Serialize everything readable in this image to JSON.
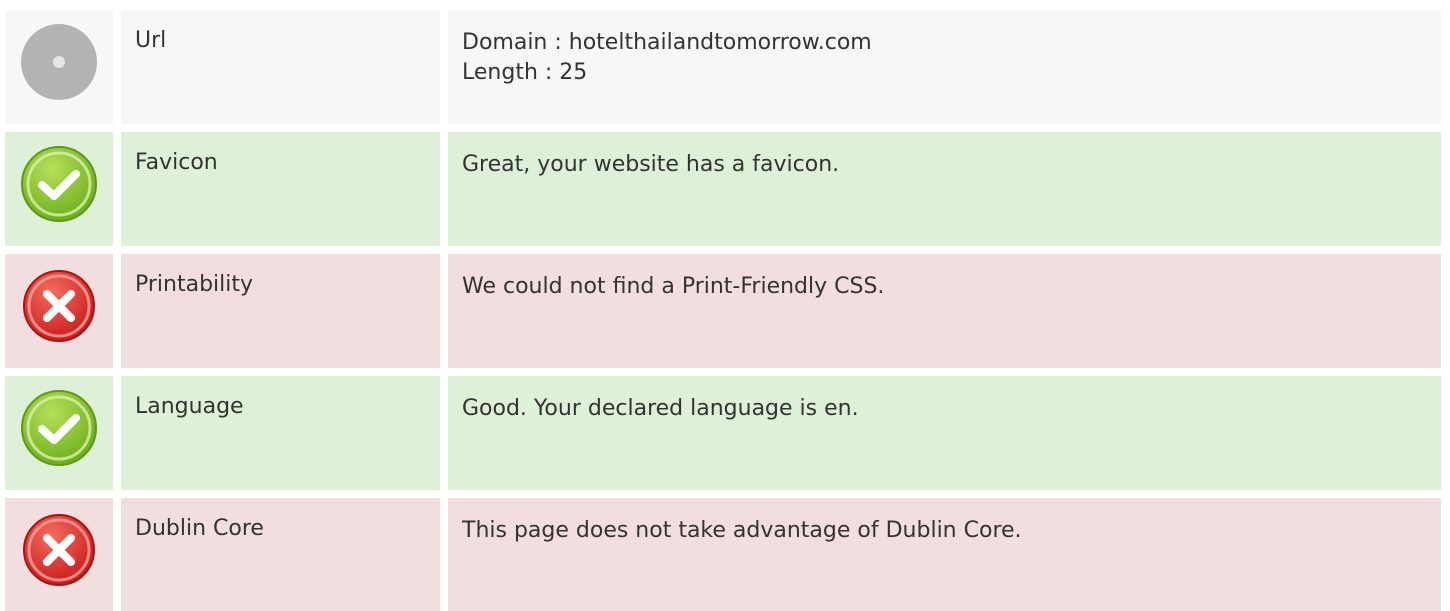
{
  "colors": {
    "neutral_bg": "#f7f7f7",
    "pass_bg": "#dff0d8",
    "fail_bg": "#f2dede",
    "text": "#333333",
    "pass_icon": "#8cc63f",
    "fail_icon": "#e0302e",
    "neutral_icon": "#b3b3b3"
  },
  "rows": [
    {
      "status": "neutral",
      "icon": "neutral-disc-icon",
      "label": "Url",
      "lines": [
        "Domain : hotelthailandtomorrow.com",
        "Length : 25"
      ]
    },
    {
      "status": "pass",
      "icon": "check-icon",
      "label": "Favicon",
      "lines": [
        "Great, your website has a favicon."
      ]
    },
    {
      "status": "fail",
      "icon": "cross-icon",
      "label": "Printability",
      "lines": [
        "We could not find a Print-Friendly CSS."
      ]
    },
    {
      "status": "pass",
      "icon": "check-icon",
      "label": "Language",
      "lines": [
        "Good. Your declared language is en."
      ]
    },
    {
      "status": "fail",
      "icon": "cross-icon",
      "label": "Dublin Core",
      "lines": [
        "This page does not take advantage of Dublin Core."
      ]
    }
  ]
}
